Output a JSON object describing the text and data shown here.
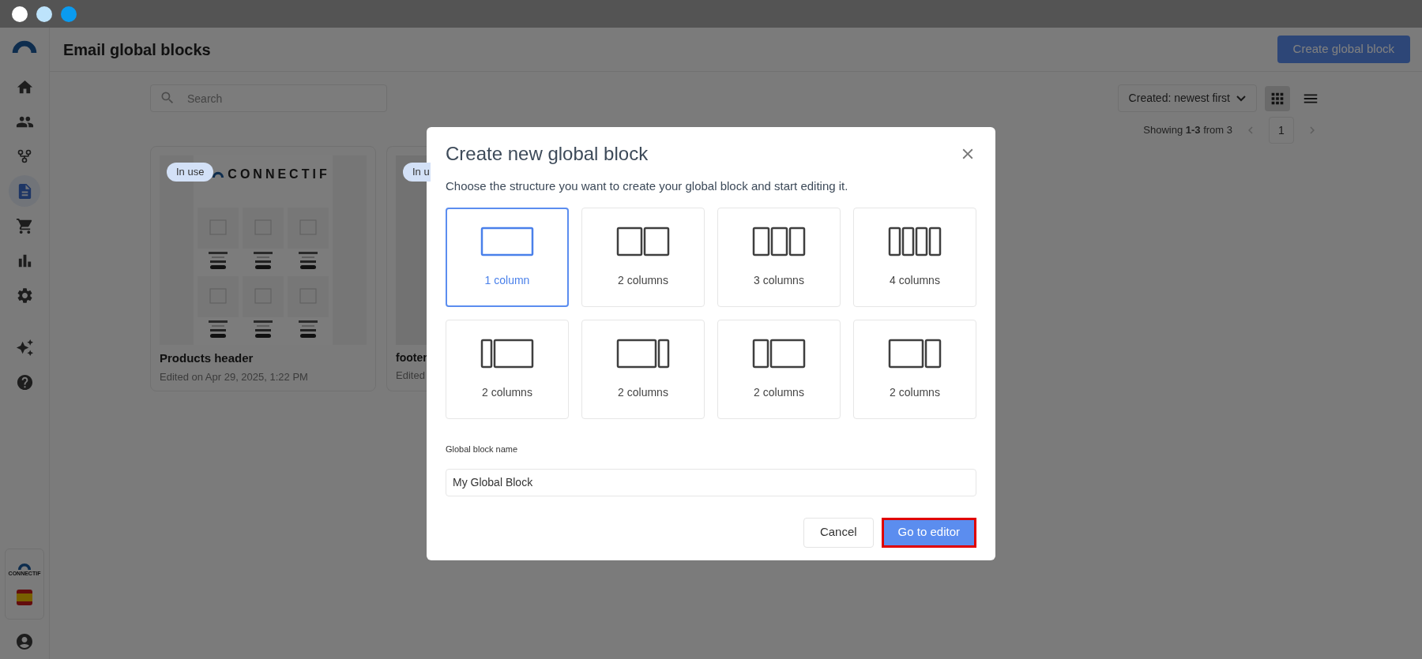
{
  "window_dots": [
    {
      "color": "#ffffff"
    },
    {
      "color": "#bde3fb"
    },
    {
      "color": "#0a9bf0"
    }
  ],
  "sidebar": {
    "items": [
      {
        "kind": "home",
        "selected": false
      },
      {
        "kind": "people",
        "selected": false
      },
      {
        "kind": "flow",
        "selected": false
      },
      {
        "kind": "document",
        "selected": true
      },
      {
        "kind": "cart",
        "selected": false
      },
      {
        "kind": "chart",
        "selected": false
      },
      {
        "kind": "settings",
        "selected": false
      },
      {
        "kind": "ai",
        "selected": false
      },
      {
        "kind": "help",
        "selected": false
      }
    ],
    "account_logo_text": "CONNECTIF"
  },
  "header": {
    "title": "Email global blocks",
    "create_button": "Create global block"
  },
  "toolbar": {
    "search": {
      "placeholder": "Search"
    },
    "sort": "Created: newest first",
    "views": [
      {
        "kind": "grid",
        "selected": true
      },
      {
        "kind": "list",
        "selected": false
      }
    ]
  },
  "pagination": {
    "showing": "Showing **1-3** from 3",
    "page": "1"
  },
  "cards": [
    {
      "badge": "In use",
      "logo": "CONNECTIF",
      "title": "Products header",
      "subtitle": "Edited on Apr 29, 2025, 1:22 PM",
      "preview": true
    },
    {
      "badge": "In u",
      "title": "footer",
      "subtitle": "Edited",
      "preview": false
    }
  ],
  "modal": {
    "title": "Create new global block",
    "description": "Choose the structure you want to create your global block and start editing it.",
    "structures": [
      {
        "kind": "one",
        "label": "1 column",
        "selected": true
      },
      {
        "kind": "two",
        "label": "2 columns",
        "selected": false
      },
      {
        "kind": "three",
        "label": "3 columns",
        "selected": false
      },
      {
        "kind": "four",
        "label": "4 columns",
        "selected": false
      },
      {
        "kind": "thin-wide",
        "label": "2 columns",
        "selected": false
      },
      {
        "kind": "wide-thin",
        "label": "2 columns",
        "selected": false
      },
      {
        "kind": "narrow-wide",
        "label": "2 columns",
        "selected": false
      },
      {
        "kind": "wide-narrow",
        "label": "2 columns",
        "selected": false
      }
    ],
    "name_label": "Global block name",
    "name_value": "My Global Block",
    "cancel": "Cancel",
    "confirm": {
      "label": "Go to editor",
      "highlighted": true
    }
  }
}
